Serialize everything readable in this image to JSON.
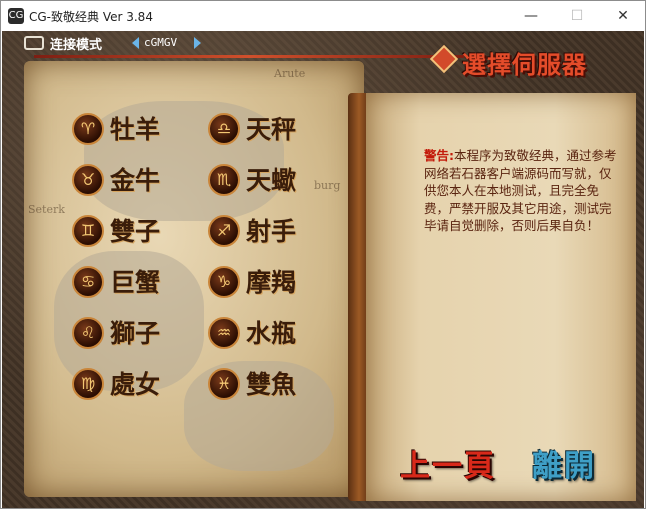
{
  "window": {
    "title": "CG-致敬经典 Ver 3.84",
    "app_icon": "CG",
    "minimize": "—",
    "maximize": "☐",
    "close": "✕"
  },
  "topbar": {
    "mode_label": "连接模式",
    "server_name": "cGMGV"
  },
  "header": {
    "title": "選擇伺服器"
  },
  "servers": [
    {
      "label": "牡羊",
      "icon": "♈"
    },
    {
      "label": "金牛",
      "icon": "♉"
    },
    {
      "label": "雙子",
      "icon": "♊"
    },
    {
      "label": "巨蟹",
      "icon": "♋"
    },
    {
      "label": "獅子",
      "icon": "♌"
    },
    {
      "label": "處女",
      "icon": "♍"
    },
    {
      "label": "天秤",
      "icon": "♎"
    },
    {
      "label": "天蠍",
      "icon": "♏"
    },
    {
      "label": "射手",
      "icon": "♐"
    },
    {
      "label": "摩羯",
      "icon": "♑"
    },
    {
      "label": "水瓶",
      "icon": "♒"
    },
    {
      "label": "雙魚",
      "icon": "♓"
    }
  ],
  "map_labels": {
    "a": "Arute",
    "b": "Seterk",
    "c": "burg"
  },
  "notice": {
    "title": "警告:",
    "body": "本程序为致敬经典，通过参考网络若石器客户端源码而写就，仅供您本人在本地测试，且完全免费，严禁开服及其它用途，测试完毕请自觉删除，否则后果自负！"
  },
  "buttons": {
    "prev": "上一頁",
    "leave": "離開"
  },
  "colors": {
    "title_red": "#e44c2a",
    "prev_red": "#d8291a",
    "leave_blue": "#3f9fc6",
    "warning_red": "#c31a0a"
  }
}
